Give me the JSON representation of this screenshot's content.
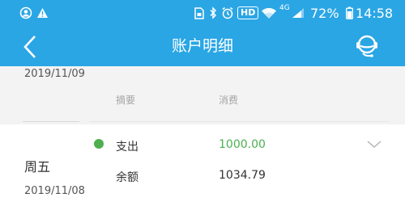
{
  "status_bar": {
    "icons": [
      "user-circle-icon",
      "warning-icon",
      "sim-card-icon",
      "bluetooth-icon",
      "alarm-clock-icon",
      "wifi-icon",
      "signal-icon",
      "battery-icon"
    ],
    "hd_label": "HD",
    "network_label": "4G",
    "battery_percent": "72%",
    "time": "14:58"
  },
  "nav": {
    "title": "账户明细",
    "back_icon": "chevron-left-icon",
    "support_icon": "customer-service-icon"
  },
  "previous_entry": {
    "date": "2019/11/09",
    "label_1": "摘要",
    "label_2": "消费"
  },
  "entry": {
    "weekday": "周五",
    "date": "2019/11/08",
    "type_label": "支出",
    "amount": "1000.00",
    "balance_label": "余额",
    "balance_value": "1034.79",
    "indicator_color": "#4caf50",
    "expand_icon": "chevron-down-icon"
  },
  "colors": {
    "header": "#2aa6e5",
    "amount": "#4caf50"
  }
}
